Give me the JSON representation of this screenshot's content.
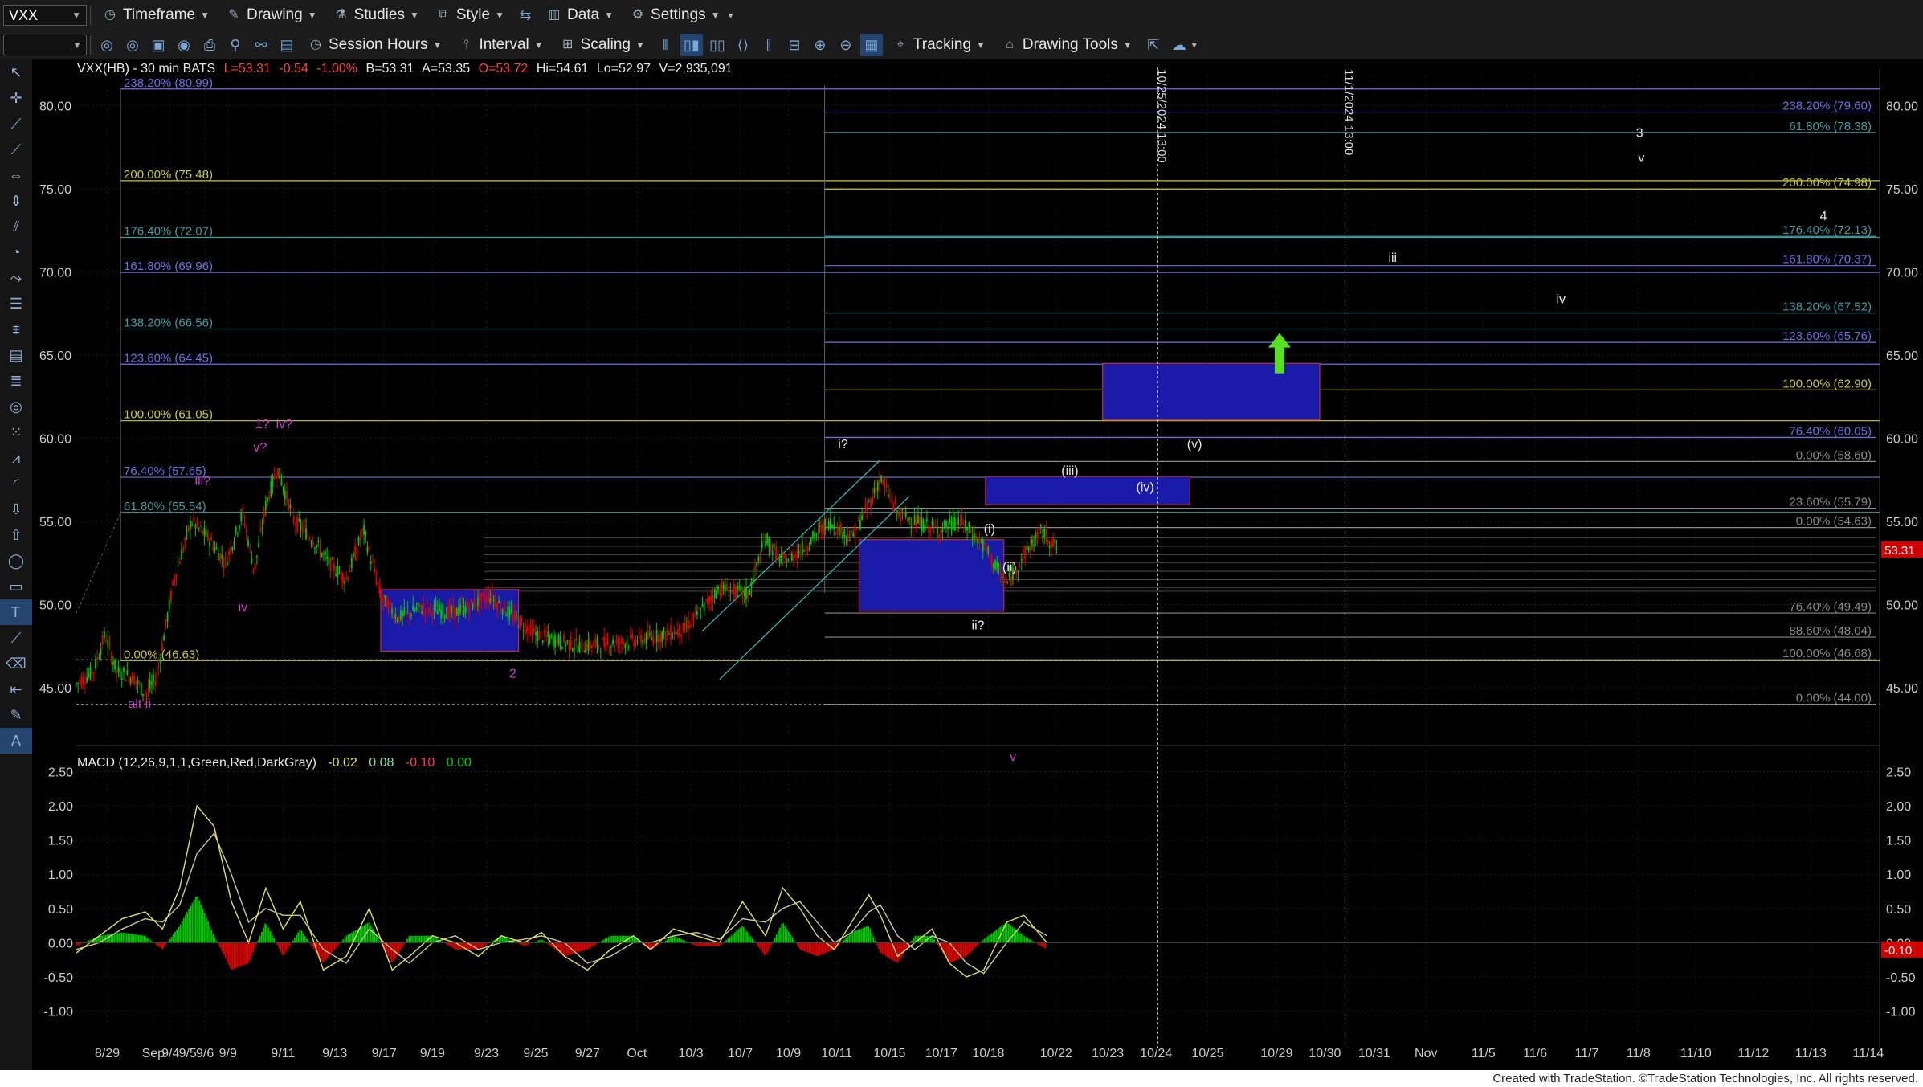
{
  "toolbar": {
    "symbol": "VXX",
    "timeframe": "Timeframe",
    "drawing": "Drawing",
    "studies": "Studies",
    "style": "Style",
    "data": "Data",
    "settings": "Settings",
    "session_hours": "Session Hours",
    "interval": "Interval",
    "scaling": "Scaling",
    "tracking": "Tracking",
    "drawing_tools": "Drawing Tools"
  },
  "footer": "Created with TradeStation. ©TradeStation Technologies, Inc. All rights reserved.",
  "colors": {
    "background": "#000000",
    "up": "#00c800",
    "down": "#e00000",
    "zone": "#1a1aa8",
    "fib_yellow": "#c8c83c",
    "fib_blue": "#6e6ee6",
    "fib_teal": "#3c9ea0",
    "wave_magenta": "#d23cd2",
    "arrow": "#55e020"
  },
  "chart_data": [
    {
      "type": "line",
      "subtype": "candlestick",
      "header": {
        "name": "VXX(HB) - 30 min  BATS",
        "last": "L=53.31",
        "chg": "-0.54",
        "pct": "-1.00%",
        "bid": "B=53.31",
        "ask": "A=53.35",
        "open": "O=53.72",
        "hi": "Hi=54.61",
        "lo": "Lo=52.97",
        "vol": "V=2,935,091"
      },
      "last_price": "53.31",
      "ylim": [
        42.2,
        81.8
      ],
      "yticks": [
        "45.00",
        "50.00",
        "55.00",
        "60.00",
        "65.00",
        "70.00",
        "75.00",
        "80.00"
      ],
      "xticks": [
        "8/29",
        "Sep",
        "9/4",
        "9/5",
        "9/6",
        "9/9",
        "9/11",
        "9/13",
        "9/17",
        "9/19",
        "9/23",
        "9/25",
        "9/27",
        "Oct",
        "10/3",
        "10/7",
        "10/9",
        "10/11",
        "10/15",
        "10/17",
        "10/18",
        "10/22",
        "10/23",
        "10/24",
        "10/25",
        "10/29",
        "10/30",
        "10/31",
        "Nov",
        "11/5",
        "11/6",
        "11/7",
        "11/8",
        "11/10",
        "11/12",
        "11/13",
        "11/14"
      ],
      "price_path": [
        [
          0,
          45.2
        ],
        [
          0.015,
          46.0
        ],
        [
          0.025,
          48.2
        ],
        [
          0.035,
          46.0
        ],
        [
          0.05,
          45.6
        ],
        [
          0.06,
          44.6
        ],
        [
          0.07,
          45.6
        ],
        [
          0.085,
          51.5
        ],
        [
          0.1,
          55.0
        ],
        [
          0.115,
          54.0
        ],
        [
          0.13,
          52.5
        ],
        [
          0.145,
          55.5
        ],
        [
          0.155,
          52.0
        ],
        [
          0.165,
          56.0
        ],
        [
          0.175,
          58.2
        ],
        [
          0.19,
          55.0
        ],
        [
          0.205,
          54.0
        ],
        [
          0.22,
          52.5
        ],
        [
          0.235,
          51.5
        ],
        [
          0.25,
          54.5
        ],
        [
          0.265,
          50.5
        ],
        [
          0.28,
          49.2
        ],
        [
          0.3,
          49.8
        ],
        [
          0.33,
          49.5
        ],
        [
          0.36,
          50.5
        ],
        [
          0.385,
          49.0
        ],
        [
          0.4,
          48.2
        ],
        [
          0.42,
          47.8
        ],
        [
          0.44,
          47.5
        ],
        [
          0.47,
          47.7
        ],
        [
          0.5,
          48.0
        ],
        [
          0.53,
          48.5
        ],
        [
          0.56,
          51.0
        ],
        [
          0.585,
          50.6
        ],
        [
          0.6,
          54.0
        ],
        [
          0.615,
          52.5
        ],
        [
          0.635,
          53.5
        ],
        [
          0.655,
          55.0
        ],
        [
          0.675,
          54.0
        ],
        [
          0.69,
          56.0
        ],
        [
          0.7,
          57.6
        ],
        [
          0.715,
          55.5
        ],
        [
          0.73,
          55.0
        ],
        [
          0.75,
          54.5
        ],
        [
          0.77,
          55.0
        ],
        [
          0.79,
          53.5
        ],
        [
          0.81,
          51.2
        ],
        [
          0.825,
          53.0
        ],
        [
          0.84,
          54.4
        ],
        [
          0.855,
          53.3
        ]
      ],
      "candle_seed_note_omitted": true,
      "fib_left": [
        {
          "label": "238.20% (80.99)",
          "value": 80.99,
          "color": "fib_blue"
        },
        {
          "label": "200.00% (75.48)",
          "value": 75.48,
          "color": "fib_yellow"
        },
        {
          "label": "176.40% (72.07)",
          "value": 72.07,
          "color": "fib_teal"
        },
        {
          "label": "161.80% (69.96)",
          "value": 69.96,
          "color": "fib_blue"
        },
        {
          "label": "138.20% (66.56)",
          "value": 66.56,
          "color": "fib_teal"
        },
        {
          "label": "123.60% (64.45)",
          "value": 64.45,
          "color": "fib_blue"
        },
        {
          "label": "100.00% (61.05)",
          "value": 61.05,
          "color": "fib_yellow"
        },
        {
          "label": "76.40% (57.65)",
          "value": 57.65,
          "color": "fib_blue"
        },
        {
          "label": "61.80% (55.54)",
          "value": 55.54,
          "color": "fib_teal"
        },
        {
          "label": "0.00% (46.63)",
          "value": 46.63,
          "color": "fib_yellow"
        }
      ],
      "fib_right": [
        {
          "label": "238.20% (79.60)",
          "value": 79.6,
          "color": "fib_blue"
        },
        {
          "label": "61.80% (78.38)",
          "value": 78.38,
          "color": "fib_teal"
        },
        {
          "label": "200.00% (74.98)",
          "value": 74.98,
          "color": "fib_yellow"
        },
        {
          "label": "176.40% (72.13)",
          "value": 72.13,
          "color": "fib_teal"
        },
        {
          "label": "161.80% (70.37)",
          "value": 70.37,
          "color": "fib_blue"
        },
        {
          "label": "138.20% (67.52)",
          "value": 67.52,
          "color": "fib_teal"
        },
        {
          "label": "123.60% (65.76)",
          "value": 65.76,
          "color": "fib_blue"
        },
        {
          "label": "100.00% (62.90)",
          "value": 62.9,
          "color": "fib_yellow"
        },
        {
          "label": "76.40% (60.05)",
          "value": 60.05,
          "color": "fib_blue"
        },
        {
          "label": "0.00% (58.60)",
          "value": 58.6,
          "color": "fib_gray"
        },
        {
          "label": "23.60% (55.79)",
          "value": 55.79,
          "color": "fib_gray"
        },
        {
          "label": "0.00% (54.63)",
          "value": 54.63,
          "color": "fib_gray"
        },
        {
          "label": "76.40% (49.49)",
          "value": 49.49,
          "color": "fib_gray"
        },
        {
          "label": "88.60% (48.04)",
          "value": 48.04,
          "color": "fib_gray"
        },
        {
          "label": "100.00% (46.68)",
          "value": 46.68,
          "color": "fib_gray"
        },
        {
          "label": "0.00% (44.00)",
          "value": 44.0,
          "color": "fib_gray"
        }
      ],
      "zones": [
        {
          "x0": 0.265,
          "x1": 0.385,
          "y0": 47.2,
          "y1": 50.9
        },
        {
          "x0": 0.6815,
          "x1": 0.8075,
          "y0": 49.6,
          "y1": 53.9
        },
        {
          "x0": 0.7915,
          "x1": 0.9695,
          "y0": 56.0,
          "y1": 57.7
        },
        {
          "x0": 0.8935,
          "x1": 1.0825,
          "y0": 61.1,
          "y1": 64.5
        }
      ],
      "vertical_dates": [
        {
          "label": "10/25/2024 13:00",
          "x": 0.9415
        },
        {
          "label": "11/1/2024 13:00",
          "x": 1.1045
        }
      ],
      "wave_labels": [
        {
          "text": "alt ii",
          "x": 0.055,
          "y": 43.8,
          "color": "wave_magenta"
        },
        {
          "text": "iv",
          "x": 0.145,
          "y": 49.6,
          "color": "wave_magenta"
        },
        {
          "text": "iii?",
          "x": 0.11,
          "y": 57.2,
          "color": "wave_magenta"
        },
        {
          "text": "v?",
          "x": 0.16,
          "y": 59.2,
          "color": "wave_magenta"
        },
        {
          "text": "1?",
          "x": 0.162,
          "y": 60.6,
          "color": "wave_magenta"
        },
        {
          "text": "iv?",
          "x": 0.181,
          "y": 60.6,
          "color": "wave_magenta"
        },
        {
          "text": "2",
          "x": 0.38,
          "y": 45.6,
          "color": "wave_magenta"
        },
        {
          "text": "v",
          "x": 0.8155,
          "y": 40.6,
          "color": "wave_magenta"
        },
        {
          "text": "i?",
          "x": 0.6675,
          "y": 59.4,
          "color": "white"
        },
        {
          "text": "ii?",
          "x": 0.785,
          "y": 48.5,
          "color": "white"
        },
        {
          "text": "(i)",
          "x": 0.795,
          "y": 54.3,
          "color": "white"
        },
        {
          "text": "(ii)",
          "x": 0.8125,
          "y": 52.0,
          "color": "white"
        },
        {
          "text": "(iii)",
          "x": 0.865,
          "y": 57.8,
          "color": "white"
        },
        {
          "text": "(iv)",
          "x": 0.9305,
          "y": 56.8,
          "color": "white"
        },
        {
          "text": "(v)",
          "x": 0.9735,
          "y": 59.4,
          "color": "white"
        },
        {
          "text": "iii",
          "x": 1.146,
          "y": 70.6,
          "color": "white"
        },
        {
          "text": "iv",
          "x": 1.2925,
          "y": 68.1,
          "color": "white"
        },
        {
          "text": "3",
          "x": 1.361,
          "y": 78.1,
          "color": "white"
        },
        {
          "text": "v",
          "x": 1.3625,
          "y": 76.6,
          "color": "white"
        },
        {
          "text": "4",
          "x": 1.521,
          "y": 73.1,
          "color": "white"
        }
      ],
      "arrow": {
        "x": 1.0475,
        "y": 64.0
      }
    },
    {
      "type": "bar",
      "title": "MACD (12,26,9,1,1,Green,Red,DarkGray)",
      "values_header": [
        "-0.02",
        "0.08",
        "-0.10",
        "0.00"
      ],
      "last_value": "-0.10",
      "ylim": [
        -1.3,
        2.6
      ],
      "yticks": [
        "2.50",
        "2.00",
        "1.50",
        "1.00",
        "0.50",
        "0.00",
        "-0.50",
        "-1.00"
      ],
      "macd_line": [
        [
          0,
          -0.15
        ],
        [
          0.02,
          0.1
        ],
        [
          0.04,
          0.35
        ],
        [
          0.06,
          0.45
        ],
        [
          0.075,
          0.2
        ],
        [
          0.09,
          0.8
        ],
        [
          0.105,
          2.0
        ],
        [
          0.12,
          1.7
        ],
        [
          0.135,
          0.6
        ],
        [
          0.15,
          0.0
        ],
        [
          0.165,
          0.8
        ],
        [
          0.18,
          0.2
        ],
        [
          0.195,
          0.6
        ],
        [
          0.215,
          -0.4
        ],
        [
          0.235,
          -0.2
        ],
        [
          0.255,
          0.5
        ],
        [
          0.275,
          -0.4
        ],
        [
          0.29,
          -0.2
        ],
        [
          0.31,
          0.1
        ],
        [
          0.33,
          0.0
        ],
        [
          0.35,
          -0.2
        ],
        [
          0.37,
          0.1
        ],
        [
          0.39,
          0.0
        ],
        [
          0.405,
          0.15
        ],
        [
          0.425,
          -0.2
        ],
        [
          0.445,
          -0.4
        ],
        [
          0.465,
          -0.1
        ],
        [
          0.485,
          0.1
        ],
        [
          0.5,
          -0.1
        ],
        [
          0.52,
          0.2
        ],
        [
          0.54,
          0.1
        ],
        [
          0.56,
          0.0
        ],
        [
          0.58,
          0.6
        ],
        [
          0.6,
          0.1
        ],
        [
          0.615,
          0.8
        ],
        [
          0.63,
          0.5
        ],
        [
          0.645,
          0.1
        ],
        [
          0.66,
          -0.1
        ],
        [
          0.675,
          0.3
        ],
        [
          0.69,
          0.7
        ],
        [
          0.7,
          0.4
        ],
        [
          0.715,
          -0.2
        ],
        [
          0.73,
          0.0
        ],
        [
          0.745,
          0.2
        ],
        [
          0.76,
          -0.3
        ],
        [
          0.775,
          -0.5
        ],
        [
          0.79,
          -0.4
        ],
        [
          0.81,
          0.3
        ],
        [
          0.825,
          0.4
        ],
        [
          0.845,
          0.0
        ]
      ],
      "signal_line": [
        [
          0,
          -0.1
        ],
        [
          0.02,
          0.0
        ],
        [
          0.04,
          0.2
        ],
        [
          0.06,
          0.35
        ],
        [
          0.075,
          0.3
        ],
        [
          0.09,
          0.55
        ],
        [
          0.105,
          1.3
        ],
        [
          0.12,
          1.6
        ],
        [
          0.135,
          1.0
        ],
        [
          0.15,
          0.3
        ],
        [
          0.165,
          0.5
        ],
        [
          0.18,
          0.4
        ],
        [
          0.195,
          0.4
        ],
        [
          0.215,
          -0.1
        ],
        [
          0.235,
          -0.3
        ],
        [
          0.255,
          0.2
        ],
        [
          0.275,
          -0.1
        ],
        [
          0.29,
          -0.3
        ],
        [
          0.31,
          0.0
        ],
        [
          0.33,
          0.1
        ],
        [
          0.35,
          -0.1
        ],
        [
          0.37,
          0.0
        ],
        [
          0.39,
          0.05
        ],
        [
          0.405,
          0.1
        ],
        [
          0.425,
          0.0
        ],
        [
          0.445,
          -0.3
        ],
        [
          0.465,
          -0.2
        ],
        [
          0.485,
          0.0
        ],
        [
          0.5,
          0.0
        ],
        [
          0.52,
          0.1
        ],
        [
          0.54,
          0.15
        ],
        [
          0.56,
          0.05
        ],
        [
          0.58,
          0.35
        ],
        [
          0.6,
          0.3
        ],
        [
          0.615,
          0.5
        ],
        [
          0.63,
          0.6
        ],
        [
          0.645,
          0.3
        ],
        [
          0.66,
          0.0
        ],
        [
          0.675,
          0.15
        ],
        [
          0.69,
          0.45
        ],
        [
          0.7,
          0.55
        ],
        [
          0.715,
          0.1
        ],
        [
          0.73,
          -0.1
        ],
        [
          0.745,
          0.1
        ],
        [
          0.76,
          0.0
        ],
        [
          0.775,
          -0.3
        ],
        [
          0.79,
          -0.45
        ],
        [
          0.81,
          0.0
        ],
        [
          0.825,
          0.3
        ],
        [
          0.845,
          0.1
        ]
      ]
    }
  ]
}
